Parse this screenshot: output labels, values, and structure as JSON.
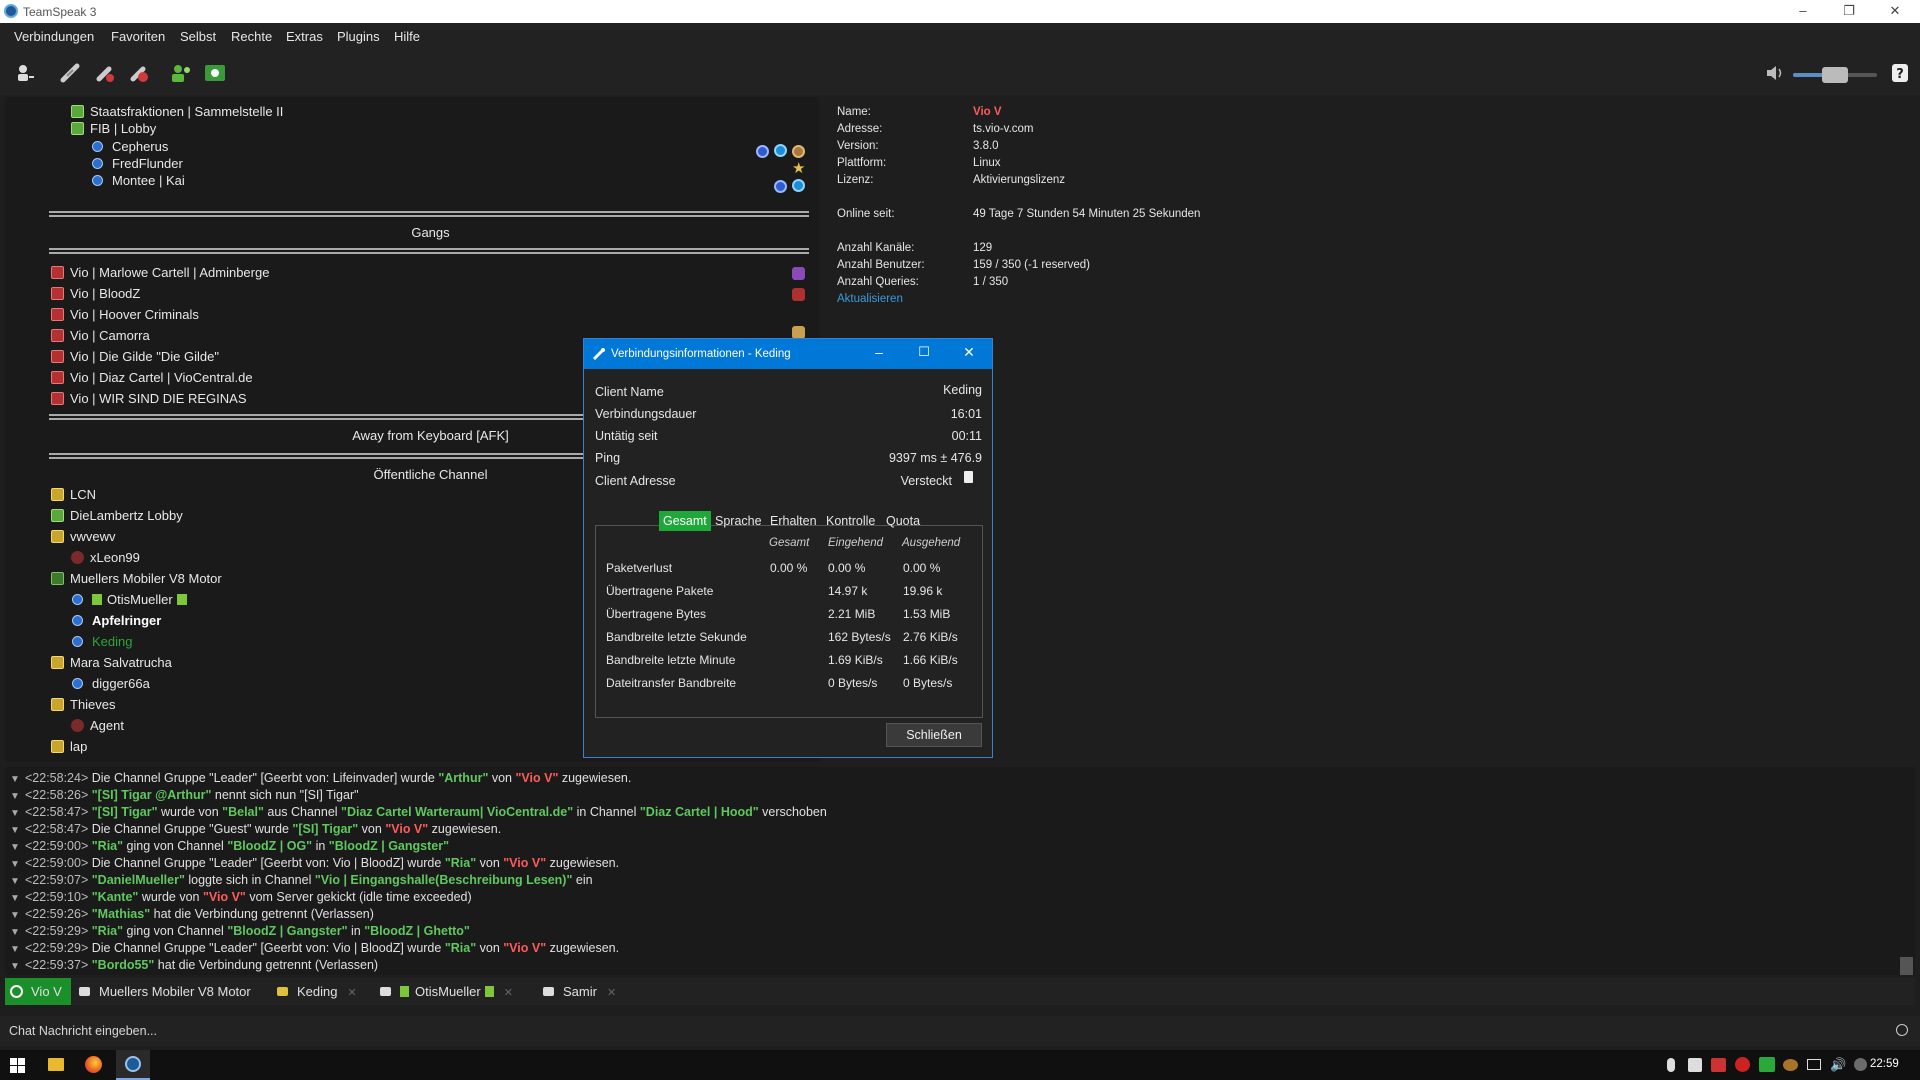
{
  "window": {
    "title": "TeamSpeak 3"
  },
  "menu": [
    "Verbindungen",
    "Favoriten",
    "Selbst",
    "Rechte",
    "Extras",
    "Plugins",
    "Hilfe"
  ],
  "toolbar": {
    "icons": [
      "connect-icon",
      "disconnect-icon",
      "mute-mic-icon",
      "mute-speaker-icon",
      "away-icon",
      "subscribe-icon"
    ],
    "volume_level": 0.5
  },
  "tree": {
    "rows": [
      {
        "label": "Staatsfraktionen | Sammelstelle II",
        "kind": "channel-green"
      },
      {
        "label": "FIB | Lobby",
        "kind": "channel-green"
      },
      {
        "label": "Cepherus",
        "kind": "user"
      },
      {
        "label": "FredFlunder",
        "kind": "user"
      },
      {
        "label": "Montee | Kai",
        "kind": "user"
      }
    ],
    "spacer_gangs": "Gangs",
    "gangs": [
      "Vio | Marlowe Cartell | Adminberge",
      "Vio | BloodZ",
      "Vio | Hoover Criminals",
      "Vio | Camorra",
      "Vio | Die Gilde \"Die Gilde\"",
      "Vio | Diaz Cartel | VioCentral.de",
      "Vio | WIR SIND DIE REGINAS"
    ],
    "spacer_afk": "Away from Keyboard [AFK]",
    "spacer_public": "Öffentliche Channel",
    "public": [
      {
        "label": "LCN",
        "kind": "channel-yellow"
      },
      {
        "label": "DieLambertz Lobby",
        "kind": "channel-green"
      },
      {
        "label": "vwvewv",
        "kind": "channel-yellow"
      },
      {
        "label": "xLeon99",
        "kind": "user-muted"
      },
      {
        "label": "Muellers Mobiler V8 Motor",
        "kind": "channel-dgreen"
      },
      {
        "label": "OtisMueller",
        "kind": "user"
      },
      {
        "label": "Apfelringer",
        "kind": "user-bold"
      },
      {
        "label": "Keding",
        "kind": "user-self"
      },
      {
        "label": "Mara Salvatrucha",
        "kind": "channel-yellow"
      },
      {
        "label": "digger66a",
        "kind": "user"
      },
      {
        "label": "Thieves",
        "kind": "channel-yellow"
      },
      {
        "label": "Agent",
        "kind": "user-muted"
      },
      {
        "label": "lap",
        "kind": "channel-yellow"
      }
    ]
  },
  "server_info": {
    "name_label": "Name:",
    "name": "Vio V",
    "address_label": "Adresse:",
    "address": "ts.vio-v.com",
    "version_label": "Version:",
    "version": "3.8.0",
    "platform_label": "Plattform:",
    "platform": "Linux",
    "license_label": "Lizenz:",
    "license": "Aktivierungslizenz",
    "online_label": "Online seit:",
    "online": "49 Tage 7 Stunden 54 Minuten 25 Sekunden",
    "channels_label": "Anzahl Kanäle:",
    "channels": "129",
    "users_label": "Anzahl Benutzer:",
    "users": "159 / 350 (-1 reserved)",
    "queries_label": "Anzahl Queries:",
    "queries": "1 / 350",
    "refresh": "Aktualisieren",
    "name_color": "#ff5b5b",
    "link_color": "#3a9ad9"
  },
  "dialog": {
    "title": "Verbindungsinformationen - Keding",
    "client_name_label": "Client Name",
    "client_name": "Keding",
    "duration_label": "Verbindungsdauer",
    "duration": "16:01",
    "idle_label": "Untätig seit",
    "idle": "00:11",
    "ping_label": "Ping",
    "ping": "9397 ms ± 476.9",
    "address_label": "Client Adresse",
    "address": "Versteckt",
    "tabs": [
      "Gesamt",
      "Sprache",
      "Erhalten",
      "Kontrolle",
      "Quota"
    ],
    "headers": [
      "Gesamt",
      "Eingehend",
      "Ausgehend"
    ],
    "stats": [
      {
        "label": "Paketverlust",
        "total": "0.00 %",
        "in": "0.00 %",
        "out": "0.00 %"
      },
      {
        "label": "Übertragene Pakete",
        "total": "",
        "in": "14.97 k",
        "out": "19.96 k"
      },
      {
        "label": "Übertragene Bytes",
        "total": "",
        "in": "2.21 MiB",
        "out": "1.53 MiB"
      },
      {
        "label": "Bandbreite letzte Sekunde",
        "total": "",
        "in": "162 Bytes/s",
        "out": "2.76 KiB/s"
      },
      {
        "label": "Bandbreite letzte Minute",
        "total": "",
        "in": "1.69 KiB/s",
        "out": "1.66 KiB/s"
      },
      {
        "label": "Dateitransfer Bandbreite",
        "total": "",
        "in": "0 Bytes/s",
        "out": "0 Bytes/s"
      }
    ],
    "close": "Schließen",
    "active_tab_color": "#1fa83a"
  },
  "log": [
    {
      "ts": "<22:58:24>",
      "parts": [
        [
          "t",
          "Die Channel Gruppe \"Leader\" [Geerbt von: Lifeinvader] wurde "
        ],
        [
          "g",
          "\"Arthur\""
        ],
        [
          "t",
          " von "
        ],
        [
          "r",
          "\"Vio V\""
        ],
        [
          "t",
          " zugewiesen."
        ]
      ]
    },
    {
      "ts": "<22:58:26>",
      "parts": [
        [
          "g",
          "\"[SI] Tigar @Arthur\""
        ],
        [
          "t",
          " nennt sich nun \"[SI] Tigar\""
        ]
      ]
    },
    {
      "ts": "<22:58:47>",
      "parts": [
        [
          "g",
          "\"[SI] Tigar\""
        ],
        [
          "t",
          " wurde von "
        ],
        [
          "g",
          "\"Belal\""
        ],
        [
          "t",
          " aus Channel "
        ],
        [
          "g",
          "\"Diaz Cartel Warteraum| VioCentral.de\""
        ],
        [
          "t",
          " in Channel "
        ],
        [
          "g",
          "\"Diaz Cartel | Hood\""
        ],
        [
          "t",
          " verschoben"
        ]
      ]
    },
    {
      "ts": "<22:58:47>",
      "parts": [
        [
          "t",
          "Die Channel Gruppe \"Guest\" wurde "
        ],
        [
          "g",
          "\"[SI] Tigar\""
        ],
        [
          "t",
          " von "
        ],
        [
          "r",
          "\"Vio V\""
        ],
        [
          "t",
          " zugewiesen."
        ]
      ]
    },
    {
      "ts": "<22:59:00>",
      "parts": [
        [
          "g",
          "\"Ria\""
        ],
        [
          "t",
          " ging von Channel "
        ],
        [
          "g",
          "\"BloodZ | OG\""
        ],
        [
          "t",
          " in "
        ],
        [
          "g",
          "\"BloodZ | Gangster\""
        ]
      ]
    },
    {
      "ts": "<22:59:00>",
      "parts": [
        [
          "t",
          "Die Channel Gruppe \"Leader\" [Geerbt von: Vio | BloodZ] wurde "
        ],
        [
          "g",
          "\"Ria\""
        ],
        [
          "t",
          " von "
        ],
        [
          "r",
          "\"Vio V\""
        ],
        [
          "t",
          " zugewiesen."
        ]
      ]
    },
    {
      "ts": "<22:59:07>",
      "parts": [
        [
          "g",
          "\"DanielMueller\""
        ],
        [
          "t",
          " loggte sich in Channel "
        ],
        [
          "g",
          "\"Vio | Eingangshalle(Beschreibung Lesen)\""
        ],
        [
          "t",
          " ein"
        ]
      ]
    },
    {
      "ts": "<22:59:10>",
      "parts": [
        [
          "g",
          "\"Kante\""
        ],
        [
          "t",
          " wurde von "
        ],
        [
          "r",
          "\"Vio V\""
        ],
        [
          "t",
          " vom Server gekickt (idle time exceeded)"
        ]
      ]
    },
    {
      "ts": "<22:59:26>",
      "parts": [
        [
          "g",
          "\"Mathias\""
        ],
        [
          "t",
          " hat die Verbindung getrennt (Verlassen)"
        ]
      ]
    },
    {
      "ts": "<22:59:29>",
      "parts": [
        [
          "g",
          "\"Ria\""
        ],
        [
          "t",
          " ging von Channel "
        ],
        [
          "g",
          "\"BloodZ | Gangster\""
        ],
        [
          "t",
          " in "
        ],
        [
          "g",
          "\"BloodZ | Ghetto\""
        ]
      ]
    },
    {
      "ts": "<22:59:29>",
      "parts": [
        [
          "t",
          "Die Channel Gruppe \"Leader\" [Geerbt von: Vio | BloodZ] wurde "
        ],
        [
          "g",
          "\"Ria\""
        ],
        [
          "t",
          " von "
        ],
        [
          "r",
          "\"Vio V\""
        ],
        [
          "t",
          " zugewiesen."
        ]
      ]
    },
    {
      "ts": "<22:59:37>",
      "parts": [
        [
          "g",
          "\"Bordo55\""
        ],
        [
          "t",
          " hat die Verbindung getrennt (Verlassen)"
        ]
      ]
    }
  ],
  "chat_tabs": [
    "Vio V",
    "Muellers Mobiler V8 Motor",
    "Keding",
    "OtisMueller",
    "Samir"
  ],
  "chat_input": {
    "placeholder": "Chat Nachricht eingeben..."
  },
  "taskbar": {
    "clock": "22:59"
  }
}
